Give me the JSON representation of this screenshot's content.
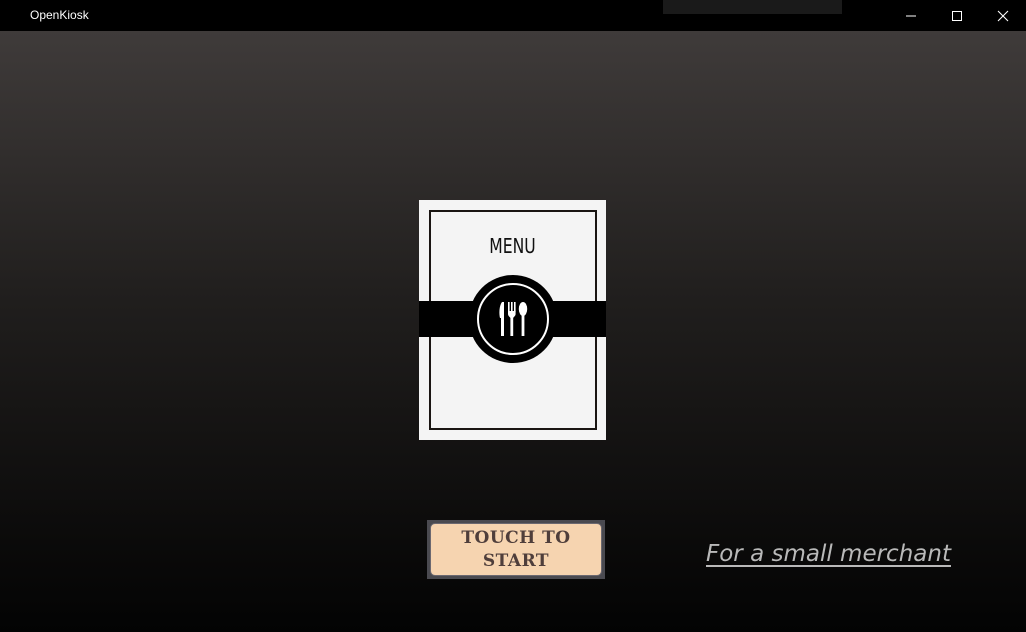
{
  "window": {
    "title": "OpenKiosk"
  },
  "menu_card": {
    "heading": "MENU",
    "icon": "cutlery-icon"
  },
  "start_button": {
    "label": "TOUCH TO START"
  },
  "tagline": {
    "text": "For a small merchant"
  },
  "colors": {
    "titlebar": "#000000",
    "background_top": "#3f3b3a",
    "background_bottom": "#030303",
    "card": "#f4f4f4",
    "button_face": "#f6d4b0",
    "button_text": "#4f3e3b",
    "tagline": "#b9b9b9"
  }
}
